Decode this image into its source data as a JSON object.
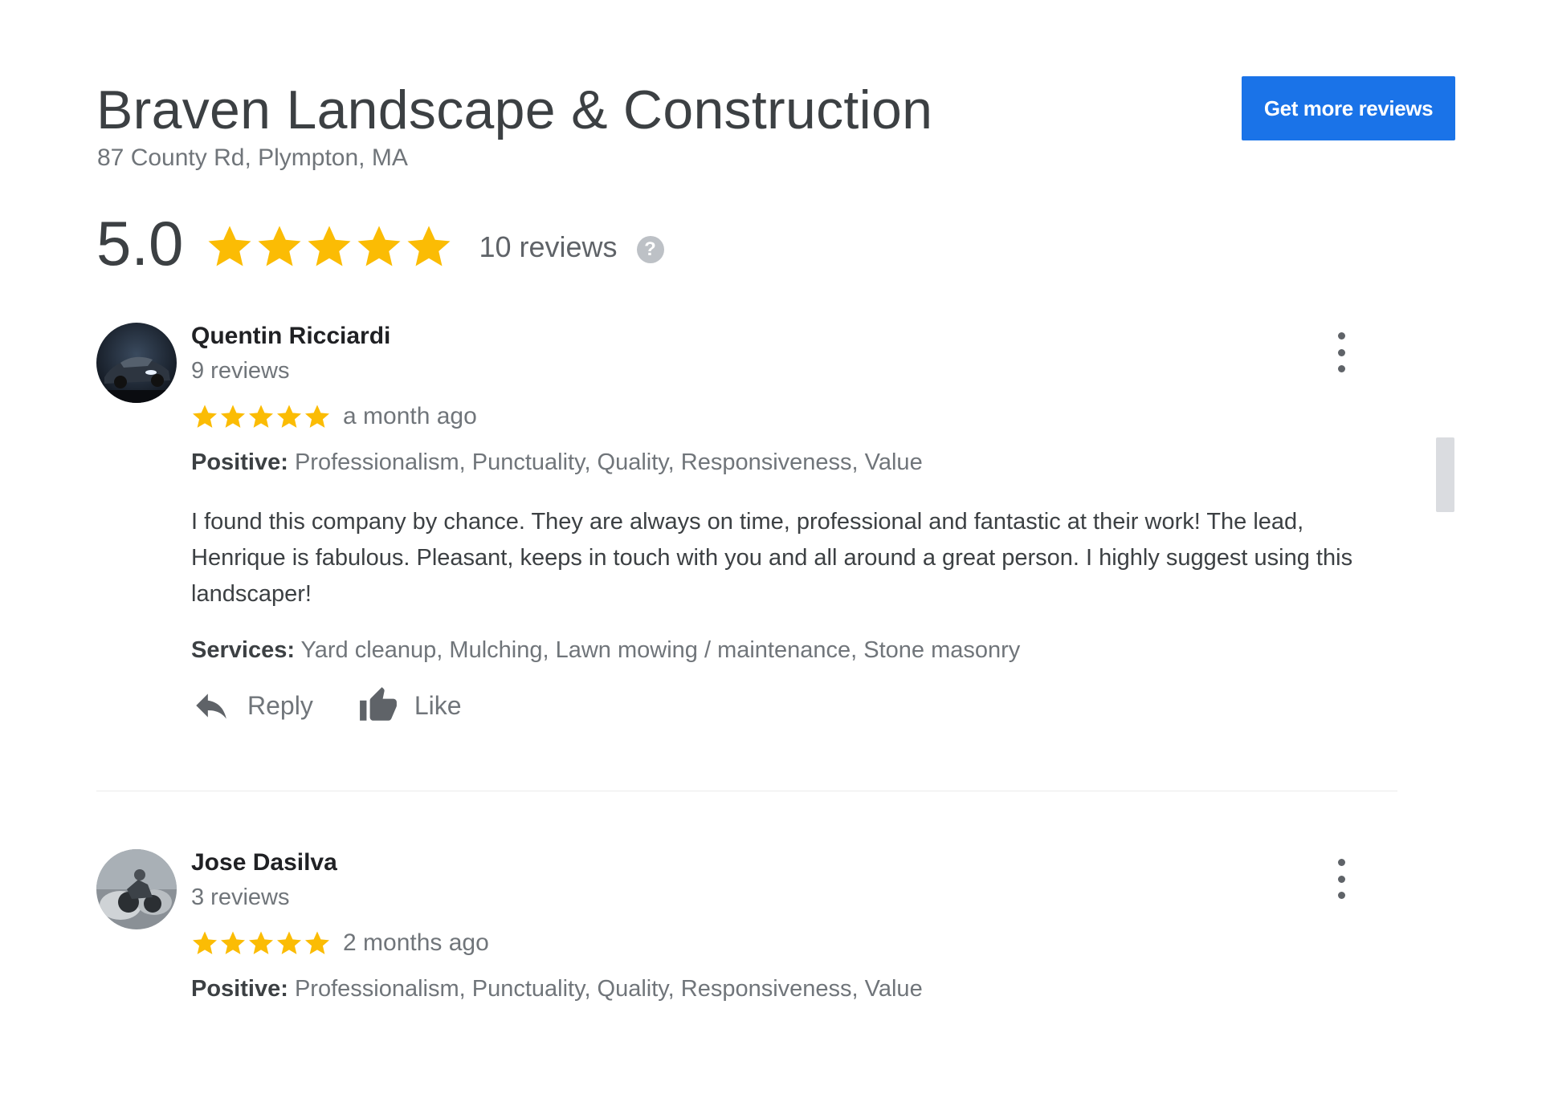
{
  "business": {
    "name": "Braven Landscape & Construction",
    "address": "87 County Rd, Plympton, MA",
    "get_more_reviews_label": "Get more reviews"
  },
  "rating": {
    "value": "5.0",
    "stars": 5,
    "review_count_label": "10 reviews",
    "help_icon": "?"
  },
  "colors": {
    "star": "#fbbc04",
    "button": "#1a73e8"
  },
  "reviews": [
    {
      "name": "Quentin Ricciardi",
      "review_count": "9 reviews",
      "stars": 5,
      "date": "a month ago",
      "positive_label": "Positive:",
      "positive_values": "Professionalism, Punctuality, Quality, Responsiveness, Value",
      "text": "I found this company by chance. They are always on time, professional and fantastic at their work! The lead, Henrique is fabulous. Pleasant, keeps in touch with you and all around a great person. I highly suggest using this landscaper!",
      "services_label": "Services:",
      "services_values": "Yard cleanup, Mulching, Lawn mowing / maintenance, Stone masonry",
      "reply_label": "Reply",
      "like_label": "Like"
    },
    {
      "name": "Jose Dasilva",
      "review_count": "3 reviews",
      "stars": 5,
      "date": "2 months ago",
      "positive_label": "Positive:",
      "positive_values": "Professionalism, Punctuality, Quality, Responsiveness, Value"
    }
  ]
}
